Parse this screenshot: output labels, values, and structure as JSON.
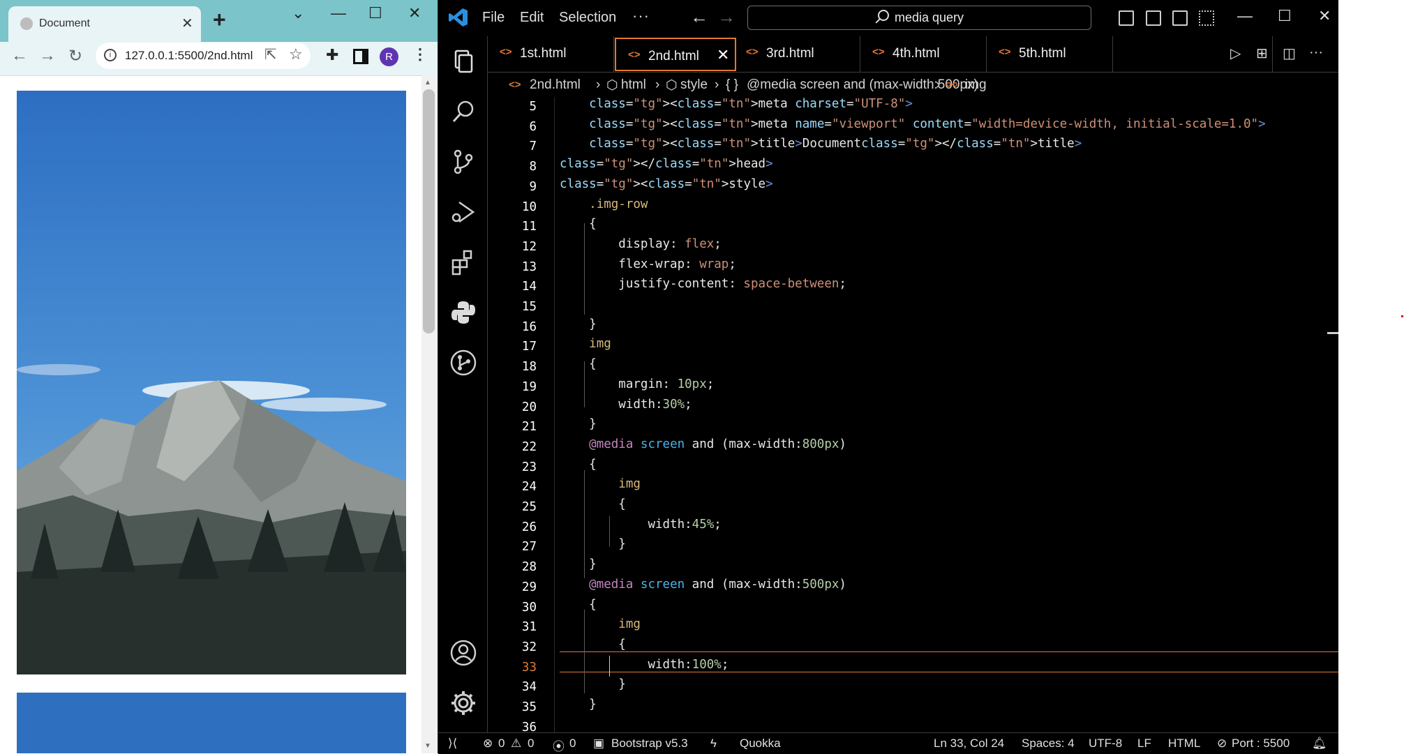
{
  "browser": {
    "tab_title": "Document",
    "new_tab": "+",
    "url": "127.0.0.1:5500/2nd.html",
    "avatar_letter": "R",
    "window_controls": [
      "⌄",
      "—",
      "☐",
      "✕"
    ]
  },
  "vscode": {
    "menu": [
      "File",
      "Edit",
      "Selection"
    ],
    "more": "···",
    "search": "media query",
    "window_controls": [
      "—",
      "☐",
      "✕"
    ],
    "tabs": [
      {
        "name": "1st.html",
        "active": false
      },
      {
        "name": "2nd.html",
        "active": true
      },
      {
        "name": "3rd.html",
        "active": false
      },
      {
        "name": "4th.html",
        "active": false
      },
      {
        "name": "5th.html",
        "active": false
      }
    ],
    "tab_close": "✕",
    "breadcrumb": [
      "2nd.html",
      "html",
      "style",
      "@media screen and (max-width:500px)",
      "img"
    ],
    "current_line": 33,
    "code": [
      {
        "n": "5",
        "t": "    <meta charset=\"UTF-8\">"
      },
      {
        "n": "6",
        "t": "    <meta name=\"viewport\" content=\"width=device-width, initial-scale=1.0\">"
      },
      {
        "n": "7",
        "t": "    <title>Document</title>"
      },
      {
        "n": "8",
        "t": "</head>"
      },
      {
        "n": "9",
        "t": "<style>"
      },
      {
        "n": "10",
        "t": "    .img-row"
      },
      {
        "n": "11",
        "t": "    {"
      },
      {
        "n": "12",
        "t": "        display: flex;"
      },
      {
        "n": "13",
        "t": "        flex-wrap: wrap;"
      },
      {
        "n": "14",
        "t": "        justify-content: space-between;"
      },
      {
        "n": "15",
        "t": ""
      },
      {
        "n": "16",
        "t": "    }"
      },
      {
        "n": "17",
        "t": "    img"
      },
      {
        "n": "18",
        "t": "    {"
      },
      {
        "n": "19",
        "t": "        margin: 10px;"
      },
      {
        "n": "20",
        "t": "        width:30%;"
      },
      {
        "n": "21",
        "t": "    }"
      },
      {
        "n": "22",
        "t": "    @media screen and (max-width:800px)"
      },
      {
        "n": "23",
        "t": "    {"
      },
      {
        "n": "24",
        "t": "        img"
      },
      {
        "n": "25",
        "t": "        {"
      },
      {
        "n": "26",
        "t": "            width:45%;"
      },
      {
        "n": "27",
        "t": "        }"
      },
      {
        "n": "28",
        "t": "    }"
      },
      {
        "n": "29",
        "t": "    @media screen and (max-width:500px)"
      },
      {
        "n": "30",
        "t": "    {"
      },
      {
        "n": "31",
        "t": "        img"
      },
      {
        "n": "32",
        "t": "        {"
      },
      {
        "n": "33",
        "t": "            width:100%;"
      },
      {
        "n": "34",
        "t": "        }"
      },
      {
        "n": "35",
        "t": "    }"
      },
      {
        "n": "36",
        "t": ""
      }
    ],
    "status": {
      "errors": "0",
      "warnings": "0",
      "ports": "0",
      "bootstrap": "Bootstrap v5.3",
      "quokka": "Quokka",
      "position": "Ln 33, Col 24",
      "spaces": "Spaces: 4",
      "encoding": "UTF-8",
      "eol": "LF",
      "language": "HTML",
      "port": "Port : 5500"
    },
    "colors": {
      "accent": "#e37933",
      "tag": "#6b8fd7",
      "number": "#b5cea8",
      "keyword": "#c586c0"
    }
  }
}
